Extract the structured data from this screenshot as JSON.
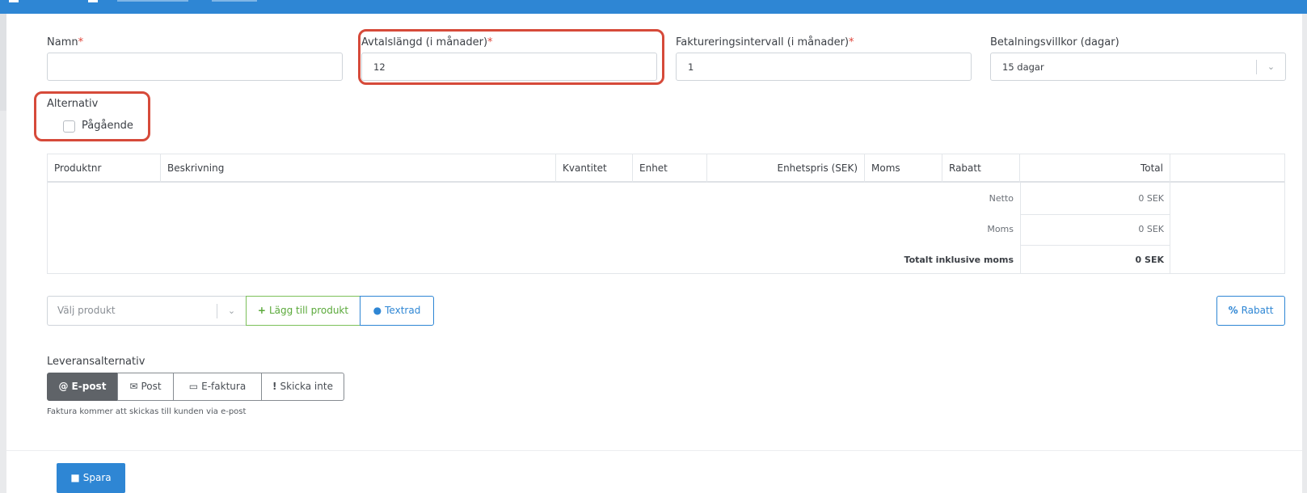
{
  "form": {
    "name_label": "Namn",
    "name_value": "",
    "duration_label": "Avtalslängd (i månader)",
    "duration_value": "12",
    "interval_label": "Faktureringsintervall (i månader)",
    "interval_value": "1",
    "payment_label": "Betalningsvillkor (dagar)",
    "payment_value": "15 dagar",
    "required_mark": "*",
    "options_label": "Alternativ",
    "ongoing_label": "Pågående",
    "ongoing_checked": false
  },
  "table": {
    "headers": [
      "Produktnr",
      "Beskrivning",
      "Kvantitet",
      "Enhet",
      "Enhetspris (SEK)",
      "Moms",
      "Rabatt",
      "Total"
    ],
    "netto_label": "Netto",
    "netto_value": "0 SEK",
    "moms_label": "Moms",
    "moms_value": "0 SEK",
    "total_label": "Totalt inklusive moms",
    "total_value": "0 SEK"
  },
  "actions": {
    "select_placeholder": "Välj produkt",
    "add_product": "Lägg till produkt",
    "textrad": "Textrad",
    "rabatt": "Rabatt"
  },
  "delivery": {
    "label": "Leveransalternativ",
    "options": [
      "E-post",
      "Post",
      "E-faktura",
      "Skicka inte"
    ],
    "selected": "E-post",
    "help_text": "Faktura kommer att skickas till kunden via e-post"
  },
  "footer": {
    "save": "Spara"
  },
  "colors": {
    "primary": "#2e86d4",
    "success": "#5aa93a",
    "highlight": "#d64a3a",
    "required": "#e0443a",
    "active_segment": "#5f6368"
  },
  "icons": {
    "chevron": "chevron-down-icon",
    "plus": "plus-icon",
    "comment": "comment-icon",
    "percent": "percent-icon",
    "at": "at-icon",
    "envelope": "envelope-open-icon",
    "monitor": "monitor-icon",
    "exclamation": "exclamation-icon",
    "save": "floppy-icon"
  }
}
